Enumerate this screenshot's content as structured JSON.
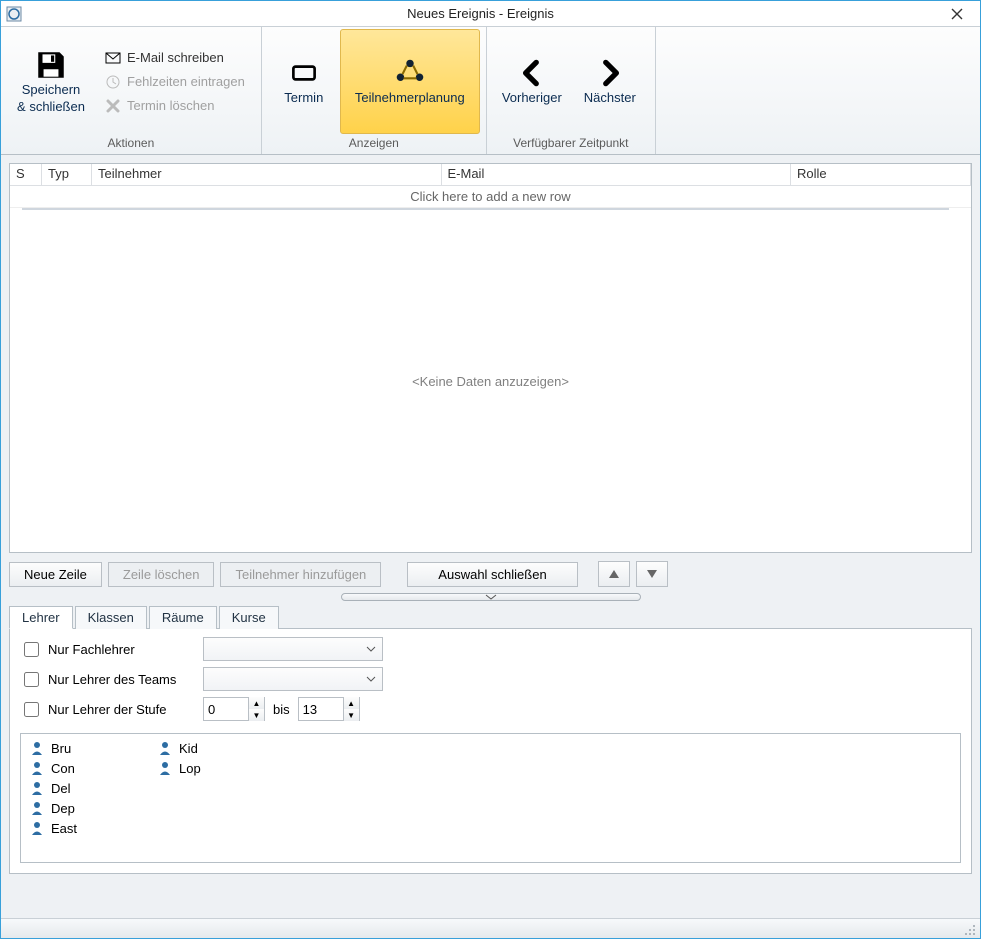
{
  "window": {
    "title": "Neues Ereignis - Ereignis"
  },
  "ribbon": {
    "groups": {
      "aktionen": {
        "label": "Aktionen",
        "save_close_line1": "Speichern",
        "save_close_line2": "& schließen",
        "email": "E-Mail schreiben",
        "fehlzeiten": "Fehlzeiten eintragen",
        "termin_loeschen": "Termin löschen"
      },
      "anzeigen": {
        "label": "Anzeigen",
        "termin": "Termin",
        "teilnehmerplanung": "Teilnehmerplanung"
      },
      "zeitpunkt": {
        "label": "Verfügbarer Zeitpunkt",
        "previous": "Vorheriger",
        "next": "Nächster"
      }
    }
  },
  "grid": {
    "headers": {
      "s": "S",
      "typ": "Typ",
      "teilnehmer": "Teilnehmer",
      "email": "E-Mail",
      "rolle": "Rolle"
    },
    "new_row_hint": "Click here to add a new row",
    "empty_text": "<Keine Daten anzuzeigen>"
  },
  "buttons": {
    "new_row": "Neue Zeile",
    "delete_row": "Zeile löschen",
    "add_participant": "Teilnehmer hinzufügen",
    "close_selection": "Auswahl schließen"
  },
  "tabs": {
    "lehrer": "Lehrer",
    "klassen": "Klassen",
    "raeume": "Räume",
    "kurse": "Kurse"
  },
  "filters": {
    "nur_fachlehrer": "Nur Fachlehrer",
    "nur_team": "Nur Lehrer des Teams",
    "nur_stufe": "Nur Lehrer der Stufe",
    "bis": "bis",
    "stufe_from": "0",
    "stufe_to": "13"
  },
  "teachers_col1": [
    "Bru",
    "Con",
    "Del",
    "Dep",
    "East"
  ],
  "teachers_col2": [
    "Kid",
    "Lop"
  ]
}
